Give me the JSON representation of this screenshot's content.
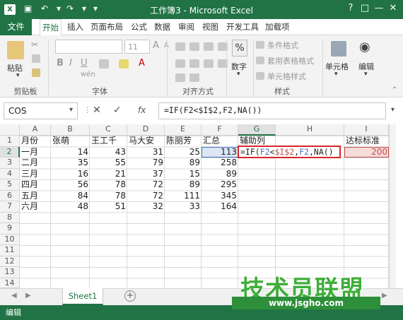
{
  "window": {
    "title": "工作簿3 - Microsoft Excel",
    "logo": "X"
  },
  "tabs": [
    {
      "label": "文件"
    },
    {
      "label": "开始"
    },
    {
      "label": "插入"
    },
    {
      "label": "页面布局"
    },
    {
      "label": "公式"
    },
    {
      "label": "数据"
    },
    {
      "label": "审阅"
    },
    {
      "label": "视图"
    },
    {
      "label": "开发工具"
    },
    {
      "label": "加载项"
    }
  ],
  "ribbon": {
    "paste": "粘贴",
    "clipboard": "剪贴板",
    "font_size": "11",
    "font_group": "字体",
    "align_group": "对齐方式",
    "number_btn": "数字",
    "cond_format": "条件格式",
    "table_format": "套用表格格式",
    "cell_style": "单元格样式",
    "style_group": "样式",
    "cells_btn": "单元格",
    "edit_btn": "编辑",
    "percent": "%"
  },
  "formula_bar": {
    "name_box": "COS",
    "fx": "fx",
    "formula": "=IF(F2<$I$2,F2,NA())"
  },
  "grid": {
    "columns": [
      "A",
      "B",
      "C",
      "D",
      "E",
      "F",
      "G",
      "H",
      "I"
    ],
    "rows": [
      "1",
      "2",
      "3",
      "4",
      "5",
      "6",
      "7",
      "8",
      "9",
      "10",
      "11",
      "12",
      "13",
      "14"
    ],
    "header_row": [
      "月份",
      "张萌",
      "王工千",
      "马大安",
      "陈丽芳",
      "汇总",
      "辅助列",
      "",
      "达标标准"
    ],
    "data": [
      [
        "一月",
        "14",
        "43",
        "31",
        "25",
        "113"
      ],
      [
        "二月",
        "35",
        "55",
        "79",
        "89",
        "258"
      ],
      [
        "三月",
        "16",
        "21",
        "37",
        "15",
        "89"
      ],
      [
        "四月",
        "56",
        "78",
        "72",
        "89",
        "295"
      ],
      [
        "五月",
        "84",
        "78",
        "72",
        "111",
        "345"
      ],
      [
        "六月",
        "48",
        "51",
        "32",
        "33",
        "164"
      ]
    ],
    "editing_formula": {
      "prefix": "=IF(",
      "ref1": "F2",
      "lt": "<",
      "ref2": "$I$2",
      "comma1": ",",
      "ref3": "F2",
      "rest": ",NA()"
    },
    "i2_value": "200"
  },
  "sheet_tab": "Sheet1",
  "status": "编辑",
  "watermark": {
    "main": "技术员联盟",
    "url": "www.jsgho.com"
  },
  "colors": {
    "accent": "#217346",
    "ref_blue": "#4472c4",
    "ref_red": "#c0504d",
    "ref_green": "#70ad47"
  }
}
